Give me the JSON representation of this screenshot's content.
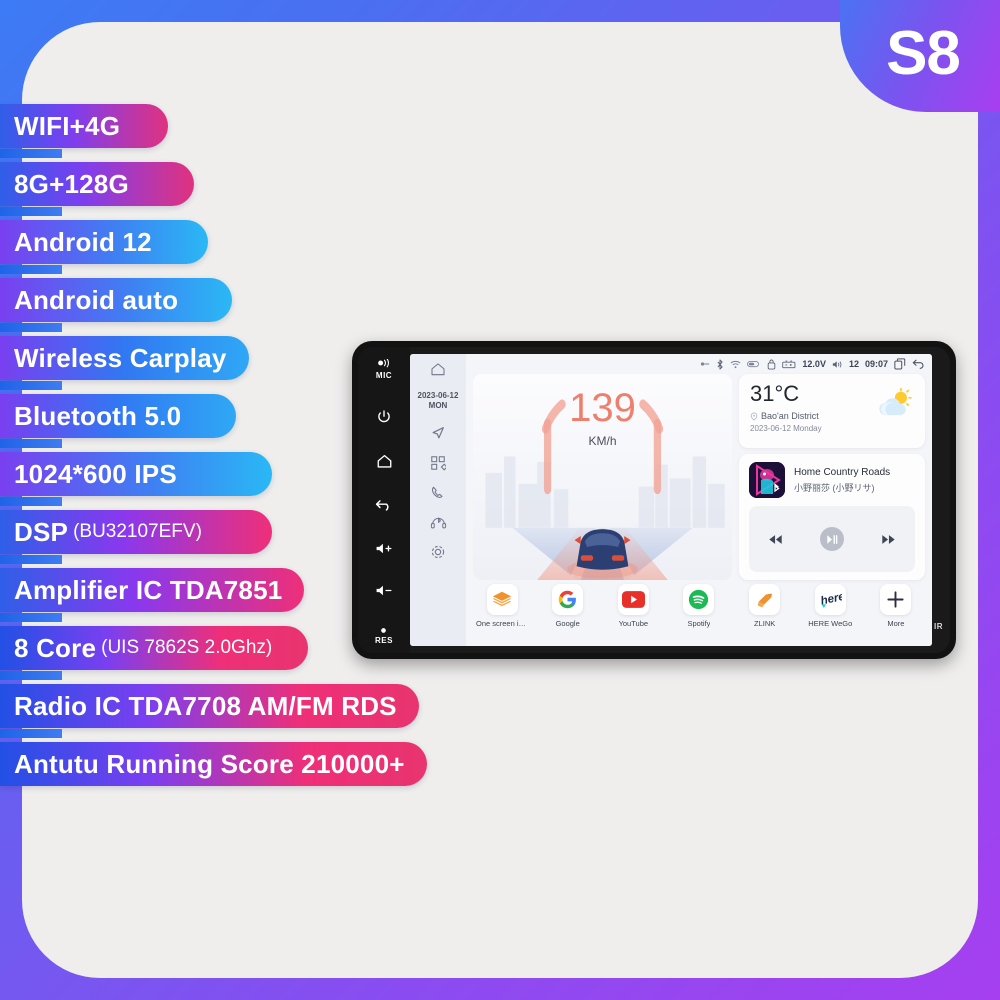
{
  "badge": {
    "model": "S8"
  },
  "features": [
    {
      "main": "WIFI+4G",
      "sub": "",
      "style": "g-pink"
    },
    {
      "main": "8G+128G",
      "sub": "",
      "style": "g-pink"
    },
    {
      "main": "Android 12",
      "sub": "",
      "style": "g-blue"
    },
    {
      "main": "Android auto",
      "sub": "",
      "style": "g-blue"
    },
    {
      "main": "Wireless Carplay",
      "sub": "",
      "style": "g-blue2"
    },
    {
      "main": "Bluetooth 5.0",
      "sub": "",
      "style": "g-blue2"
    },
    {
      "main": "1024*600 IPS",
      "sub": "",
      "style": "g-blue"
    },
    {
      "main": "DSP",
      "sub": "(BU32107EFV)",
      "style": "g-pinkwide"
    },
    {
      "main": "Amplifier IC TDA7851",
      "sub": "",
      "style": "g-pinkwide"
    },
    {
      "main": "8 Core",
      "sub": "(UIS 7862S 2.0Ghz)",
      "style": "g-mix"
    },
    {
      "main": "Radio IC TDA7708 AM/FM RDS",
      "sub": "",
      "style": "g-mix"
    },
    {
      "main": "Antutu Running Score 210000+",
      "sub": "",
      "style": "g-mix"
    }
  ],
  "unit": {
    "hardware_buttons": [
      {
        "icon": "mic-icon",
        "label": "MIC"
      },
      {
        "icon": "power-icon",
        "label": ""
      },
      {
        "icon": "home-icon",
        "label": ""
      },
      {
        "icon": "back-icon",
        "label": ""
      },
      {
        "icon": "volume-up-icon",
        "label": ""
      },
      {
        "icon": "volume-down-icon",
        "label": ""
      },
      {
        "icon": "reset-icon",
        "label": "RES"
      }
    ],
    "ir_label": "IR"
  },
  "nav_rail": {
    "date": "2023-06-12",
    "weekday": "MON",
    "items": [
      "home-icon",
      "navigation-icon",
      "apps-grid-icon",
      "phone-icon",
      "bluetooth-headset-icon",
      "settings-icon"
    ]
  },
  "status_bar": {
    "icons": [
      "usb-icon",
      "bluetooth-icon",
      "wifi-icon",
      "battery-icon",
      "gps-lock-icon",
      "car-battery-icon"
    ],
    "voltage": "12.0V",
    "volume": "12",
    "time": "09:07",
    "right_icons": [
      "recents-icon",
      "back-icon"
    ]
  },
  "speed_widget": {
    "value": "139",
    "unit": "KM/h"
  },
  "weather": {
    "temperature": "31°C",
    "location": "Bao'an District",
    "date": "2023-06-12 Monday",
    "icon": "sun-behind-cloud-icon"
  },
  "music": {
    "title": "Home Country Roads",
    "artist": "小野丽莎 (小野リサ)",
    "prev_label": "prev-track-icon",
    "play_label": "play-pause-icon",
    "next_label": "next-track-icon"
  },
  "dock_apps": [
    {
      "label": "One screen in...",
      "icon": "layers-icon"
    },
    {
      "label": "Google",
      "icon": "google-icon"
    },
    {
      "label": "YouTube",
      "icon": "youtube-icon"
    },
    {
      "label": "Spotify",
      "icon": "spotify-icon"
    },
    {
      "label": "ZLINK",
      "icon": "zlink-icon"
    },
    {
      "label": "HERE WeGo",
      "icon": "here-wego-icon"
    },
    {
      "label": "More",
      "icon": "plus-icon"
    }
  ]
}
